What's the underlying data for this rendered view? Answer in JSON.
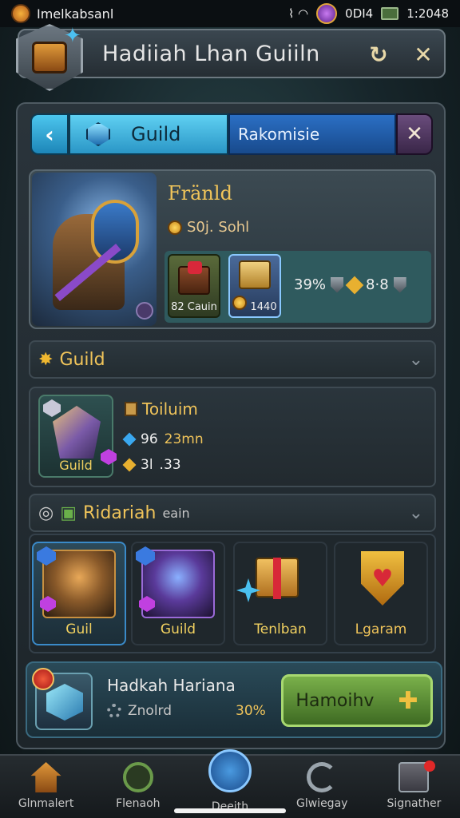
{
  "status_bar": {
    "app_name": "Imelkabsanl",
    "network": "0DI4",
    "time": "1:2048"
  },
  "header": {
    "title": "Hadiiah Lhan Guiiln"
  },
  "tabs": {
    "guild": "Guild",
    "ranking": "Rakomisie"
  },
  "profile": {
    "name": "Fränld",
    "sub": "S0j. Sohl",
    "item_a": "82 Cauin",
    "item_b": "1440",
    "stat_pct": "39%",
    "stat_val": "8·8"
  },
  "guild_section": {
    "title": "Guild",
    "icon_label": "Guild",
    "resource_title": "Toiluim",
    "stat1_a": "96",
    "stat1_b": "23mn",
    "stat2_a": "3l",
    "stat2_b": ".33"
  },
  "rewards_section": {
    "title": "Ridariah",
    "title_suffix": "eain",
    "items": [
      {
        "label": "Guil"
      },
      {
        "label": "Guild"
      },
      {
        "label": "Tenlban"
      },
      {
        "label": "Lgaram"
      }
    ]
  },
  "event": {
    "title": "Hadkah Hariana",
    "sub": "Znolrd",
    "pct": "30%",
    "button": "Hamoihv"
  },
  "bottom_nav": {
    "items": [
      {
        "label": "Glnmalert"
      },
      {
        "label": "Flenaoh"
      },
      {
        "label": "Deeith"
      },
      {
        "label": "Glwiegay"
      },
      {
        "label": "Signather"
      }
    ]
  },
  "colors": {
    "accent_gold": "#f0c45a",
    "tab_active": "#2a96c6",
    "button_green": "#7ab04a"
  }
}
